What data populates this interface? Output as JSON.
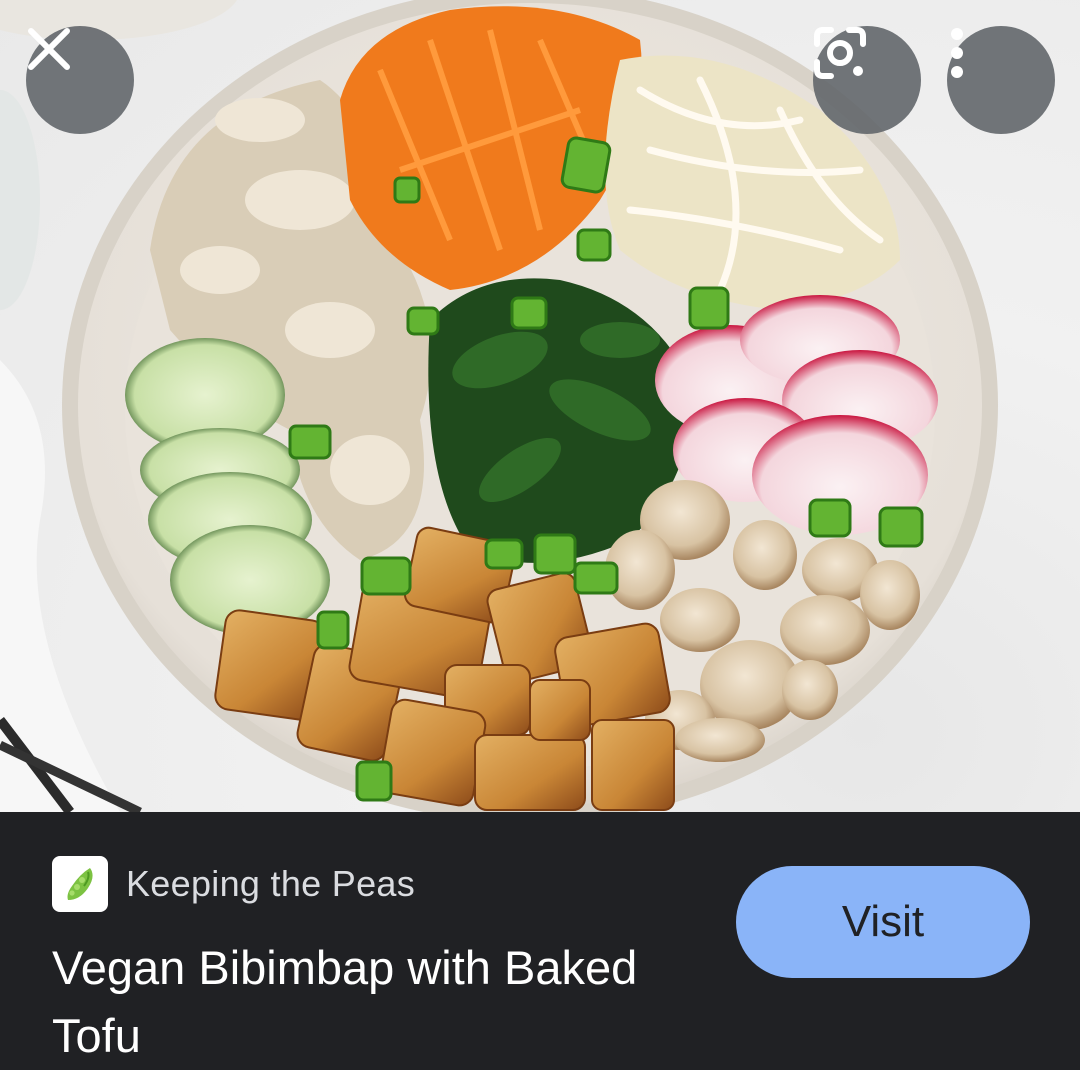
{
  "toolbar": {
    "close_icon": "close-icon",
    "lens_icon": "google-lens-icon",
    "more_icon": "more-vert-icon"
  },
  "image": {
    "subject": "vegan-bibimbap-bowl-photo"
  },
  "result": {
    "source_icon": "pea-pod-icon",
    "source_name": "Keeping the Peas",
    "title": "Vegan Bibimbap with Baked Tofu",
    "visit_label": "Visit"
  },
  "colors": {
    "panel_bg": "#202124",
    "visit_button": "#8ab4f8",
    "title_text": "#ffffff",
    "source_text": "#dadce0",
    "overlay_button": "#5f6368"
  }
}
